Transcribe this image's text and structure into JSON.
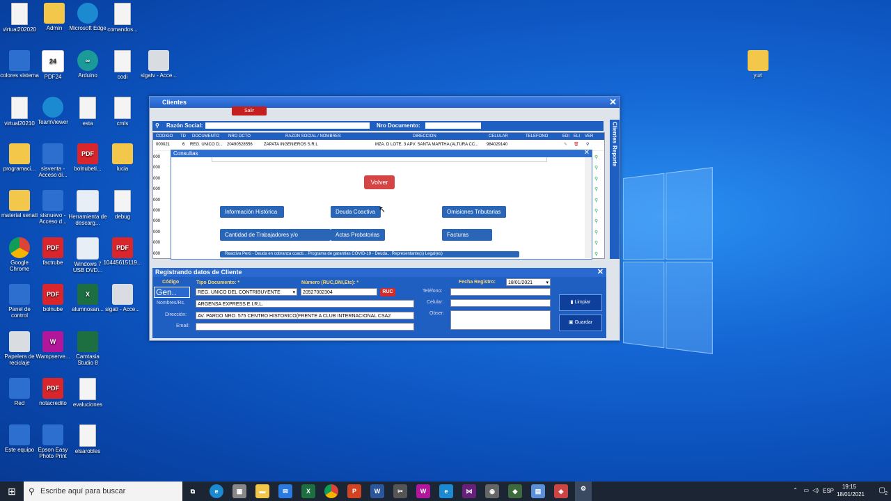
{
  "desktop": {
    "icons": [
      {
        "label": "virtual202020",
        "icon": "pdf-file-icon"
      },
      {
        "label": "Admin",
        "icon": "user-folder-icon"
      },
      {
        "label": "Microsoft Edge",
        "icon": "edge-icon"
      },
      {
        "label": "comandos...",
        "icon": "text-file-icon"
      },
      {
        "label": "colores sistema",
        "icon": "image-file-icon"
      },
      {
        "label": "PDF24",
        "icon": "pdf24-icon"
      },
      {
        "label": "Arduino",
        "icon": "arduino-icon"
      },
      {
        "label": "codi",
        "icon": "text-file-icon"
      },
      {
        "label": "sigatv - Acce...",
        "icon": "app-icon"
      },
      {
        "label": "virtual20210",
        "icon": "pdf-file-icon"
      },
      {
        "label": "TeamViewer",
        "icon": "teamviewer-icon"
      },
      {
        "label": "esta",
        "icon": "text-file-icon"
      },
      {
        "label": "cmls",
        "icon": "text-file-icon"
      },
      {
        "label": "programaci...",
        "icon": "folder-icon"
      },
      {
        "label": "sisventa - Acceso di...",
        "icon": "sync-icon"
      },
      {
        "label": "bolnubeti...",
        "icon": "pdf-icon"
      },
      {
        "label": "lucia",
        "icon": "folder-icon"
      },
      {
        "label": "material senati",
        "icon": "folder-icon"
      },
      {
        "label": "sisnuevo - Acceso d...",
        "icon": "doc-icon"
      },
      {
        "label": "Herramienta de descarg...",
        "icon": "installer-icon"
      },
      {
        "label": "debug",
        "icon": "text-file-icon"
      },
      {
        "label": "Google Chrome",
        "icon": "chrome-icon"
      },
      {
        "label": "factrube",
        "icon": "pdf-icon"
      },
      {
        "label": "Windows 7 USB DVD...",
        "icon": "installer-icon"
      },
      {
        "label": "10445615119...",
        "icon": "pdf-icon"
      },
      {
        "label": "Panel de control",
        "icon": "control-panel-icon"
      },
      {
        "label": "bolnube",
        "icon": "pdf-icon"
      },
      {
        "label": "alumnosan...",
        "icon": "excel-icon"
      },
      {
        "label": "sigati - Acce...",
        "icon": "app-icon"
      },
      {
        "label": "Papelera de reciclaje",
        "icon": "recycle-bin-icon"
      },
      {
        "label": "Wampserve...",
        "icon": "wamp-icon"
      },
      {
        "label": "Camtasia Studio 8",
        "icon": "camtasia-icon"
      },
      {
        "label": "Red",
        "icon": "network-icon"
      },
      {
        "label": "notacredito",
        "icon": "pdf-icon"
      },
      {
        "label": "evaluciones",
        "icon": "text-file-icon"
      },
      {
        "label": "Este equipo",
        "icon": "computer-icon"
      },
      {
        "label": "Epson Easy Photo Print",
        "icon": "epson-icon"
      },
      {
        "label": "elsarobles",
        "icon": "text-file-icon"
      },
      {
        "label": "yuri",
        "icon": "folder-icon"
      }
    ]
  },
  "clientes": {
    "title": "Clientes",
    "salir": "Salir",
    "razon_social_label": "Razón Social:",
    "nro_documento_label": "Nro Documento:",
    "side_tabs": [
      "Clientes",
      "Reporte"
    ],
    "columns": [
      "CODIGO",
      "TD",
      "DOCUMENTO",
      "NRO DCTO",
      "RAZON SOCIAL / NOMBRES",
      "DIRECCION",
      "CELULAR",
      "TELEFONO",
      "EDI",
      "ELI",
      "VER"
    ],
    "first_row": {
      "codigo": "000021",
      "td": "6",
      "documento": "REG. UNICO D...",
      "nro": "20490528556",
      "razon": "ZAPATA INGENIEROS S.R.L",
      "direccion": "MZA. D LOTE. 3 APV. SANTA MARTHA (ALTURA CC...",
      "celular": "984029140"
    },
    "row_codes": [
      "000",
      "000",
      "000",
      "000",
      "000",
      "000",
      "000",
      "000",
      "000",
      "000"
    ]
  },
  "consultas": {
    "title": "Consultas",
    "volver": "Volver",
    "buttons": [
      "Información Histórica",
      "Deuda Coactiva",
      "Omisiones Tributarias",
      "Cantidad de Trabajadores y/o Prestadores",
      "Actas Probatorias",
      "Facturas Fisicas"
    ],
    "truncated_button": "Reactiva Perú - Deuda en cobranza coacti... Programa de garantías COVID-19 - Deuda... Representante(s) Legal(es)"
  },
  "registro": {
    "title": "Registrando datos de Cliente",
    "codigo_label": "Código",
    "codigo_value": "Gen..",
    "tipo_doc_label": "Tipo Documento: *",
    "tipo_doc_value": "REG. UNICO DEL CONTRIBUYENTE",
    "numero_label": "Número (RUC,DNI,Etc): *",
    "numero_value": "20527002304",
    "ruc_button": "RUC",
    "fecha_label": "Fecha Registro:",
    "fecha_value": "18/01/2021",
    "nombres_label": "Nombres/Rs.",
    "nombres_value": "ARGENSA EXPRESS E.I.R.L.",
    "direccion_label": "Dirección:",
    "direccion_value": "AV. PARDO NRO. 575 CENTRO HISTORICO(FRENTE A CLUB INTERNACIONAL CSA2",
    "email_label": "Email:",
    "telefono_label": "Teléfono:",
    "celular_label": "Celular:",
    "obser_label": "Obser:",
    "limpiar": "Limpiar",
    "guardar": "Guardar"
  },
  "taskbar": {
    "search_placeholder": "Escribe aquí para buscar",
    "lang": "ESP",
    "time": "19:15",
    "date": "18/01/2021",
    "notifications": "2"
  }
}
